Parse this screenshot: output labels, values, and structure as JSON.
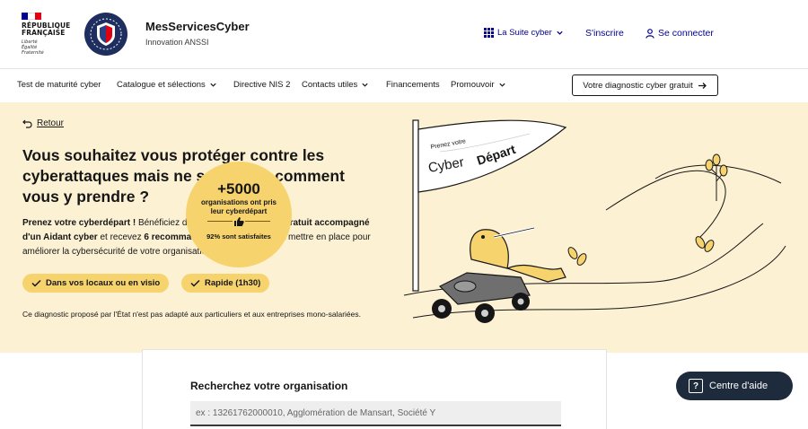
{
  "header": {
    "gov_logo": {
      "name": "RÉPUBLIQUE\nFRANÇAISE",
      "motto": "Liberté\nÉgalité\nFraternité"
    },
    "anssi_logo": "anssi-logo-icon",
    "site_title": "MesServicesCyber",
    "site_subtitle": "Innovation ANSSI",
    "tools": {
      "suite": "La Suite cyber",
      "register": "S'inscrire",
      "login": "Se connecter"
    }
  },
  "nav": {
    "items": [
      {
        "label": "Test de maturité cyber",
        "dropdown": false
      },
      {
        "label": "Catalogue et sélections",
        "dropdown": true
      },
      {
        "label": "Directive NIS 2",
        "dropdown": false
      },
      {
        "label": "Contacts utiles",
        "dropdown": true
      },
      {
        "label": "Financements",
        "dropdown": false
      },
      {
        "label": "Promouvoir",
        "dropdown": true
      }
    ],
    "cta": "Votre diagnostic cyber gratuit"
  },
  "hero": {
    "back": "Retour",
    "title": "Vous souhaitez vous protéger contre les cyberattaques mais ne savez pas comment vous y prendre ?",
    "intro_bold_1": "Prenez votre cyberdépart !",
    "intro_1": " Bénéficiez d'un ",
    "intro_bold_2": "premier diagnostic gratuit accompagné d'un Aidant cyber",
    "intro_2": " et recevez ",
    "intro_bold_3": "6 recommandations prioritaires",
    "intro_3": " à mettre en place pour améliorer la cybersécurité de votre organisation.",
    "tags": [
      "Dans vos locaux ou en visio",
      "Rapide (1h30)"
    ],
    "disclaimer": "Ce diagnostic proposé par l'État n'est pas adapté aux particuliers et aux entreprises mono-salariées.",
    "flag_small": "Prenez votre",
    "flag_big_1": "Cyber",
    "flag_big_2": "Départ",
    "stat": {
      "value": "+5000",
      "label": "organisations ont pris leur cyberdépart",
      "satisfaction": "92% sont satisfaites"
    }
  },
  "search": {
    "label": "Recherchez votre organisation",
    "placeholder": "ex : 13261762000010, Agglomération de Mansart, Société Y"
  },
  "help": {
    "label": "Centre d'aide"
  },
  "colors": {
    "primary_blue": "#000091",
    "hero_bg": "#fdf1d4",
    "accent_yellow": "#f6d36d",
    "help_bg": "#1e2b3c"
  }
}
